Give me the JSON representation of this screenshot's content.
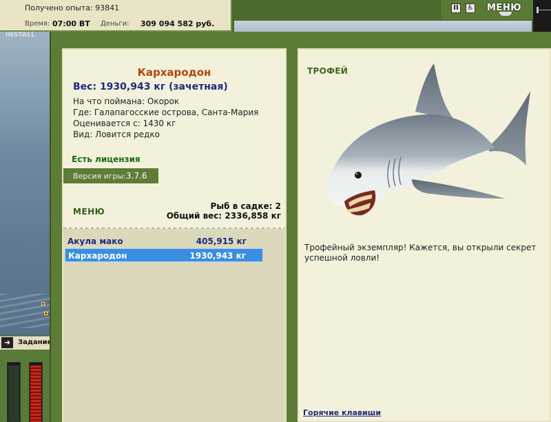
{
  "hud": {
    "experience": "Получено опыта: 93841",
    "time_label": "Время:",
    "time_value": "07:00 ВТ",
    "money_label": "Деньги:",
    "money_value": "309 094 582 руб.",
    "install_text": "INSTALL",
    "task_label": "Задание",
    "task_arrow_icon": "arrow-right-icon"
  },
  "topbar": {
    "pause_icon": "pause-icon",
    "settings_icon": "wheelchair-icon",
    "menu_label": "МЕНЮ"
  },
  "fish": {
    "name": "Кархародон",
    "weight": "Вес: 1930,943 кг (зачетная)",
    "bait": "На что поймана: Окорок",
    "place": "Где: Галапагосские острова, Санта-Мария",
    "price": "Оценивается с: 1430 кг",
    "rarity": "Вид: Ловится редко"
  },
  "license": "Есть лицензия",
  "version": {
    "label": "Версия игры:",
    "number": "3.7.6"
  },
  "cage": {
    "menu_label": "МЕНЮ",
    "count": "Рыб в садке: 2",
    "total_weight": "Общий вес: 2336,858 кг",
    "items": [
      {
        "name": "Акула мако",
        "weight": "405,915 кг",
        "selected": false
      },
      {
        "name": "Кархародон",
        "weight": "1930,943 кг",
        "selected": true
      }
    ]
  },
  "trophy": {
    "title": "ТРОФЕЙ",
    "text": "Трофейный экземпляр! Кажется, вы открыли секрет успешной ловли!",
    "image_icon": "shark-image",
    "hotkeys": "Горячие клавиши"
  },
  "colors": {
    "selected_row": "#3a8ee0",
    "panel_bg": "#f3f1dc",
    "frame_green": "#5d7c38",
    "fish_name": "#b0450e",
    "link_blue": "#1c2b7a"
  }
}
